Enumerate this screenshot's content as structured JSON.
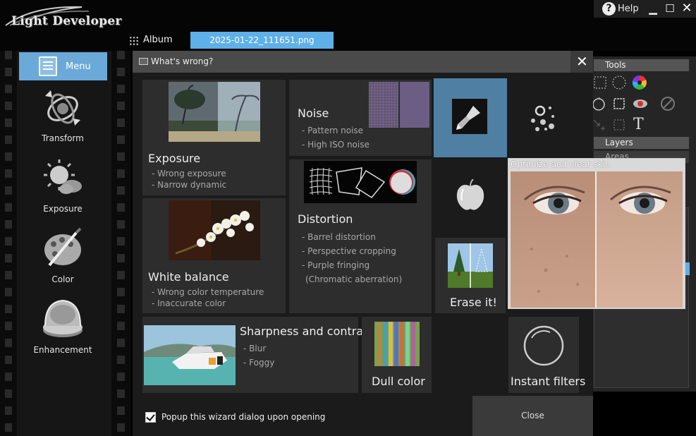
{
  "app": {
    "title": "Light Developer"
  },
  "window_controls": {
    "help": "Help",
    "help_glyph": "?",
    "minimize": "▁",
    "maximize": "☐",
    "close": "✕"
  },
  "header": {
    "album_label": "Album",
    "file_tab": "2025-01-22_111651.png"
  },
  "sidebar": {
    "menu_label": "Menu",
    "items": [
      {
        "label": "Transform",
        "icon": "transform-icon"
      },
      {
        "label": "Exposure",
        "icon": "exposure-icon"
      },
      {
        "label": "Color",
        "icon": "color-palette-icon"
      },
      {
        "label": "Enhancement",
        "icon": "enhancement-compact-icon"
      }
    ]
  },
  "right_panel": {
    "tools_header": "Tools",
    "layers_header": "Layers",
    "areas_header": "Areas",
    "text_tool_glyph": "T"
  },
  "dialog": {
    "title": "What's wrong?",
    "close_glyph": "✕",
    "cards": {
      "exposure": {
        "title": "Exposure",
        "items": [
          "- Wrong exposure",
          "- Narrow dynamic"
        ]
      },
      "noise": {
        "title": "Noise",
        "items": [
          "- Pattern noise",
          "- High ISO noise"
        ]
      },
      "white_balance": {
        "title": "White balance",
        "items": [
          "- Wrong color temperature",
          "- Inaccurate color"
        ]
      },
      "distortion": {
        "title": "Distortion",
        "items": [
          "- Barrel distortion",
          "- Perspective cropping",
          "- Purple fringing",
          "(Chromatic aberration)"
        ]
      },
      "sharpness": {
        "title": "Sharpness and contrast",
        "items": [
          "- Blur",
          "- Foggy"
        ]
      },
      "dull_color": {
        "title": "Dull color"
      },
      "erase_it": {
        "title": "Erase it!"
      },
      "instant_filters": {
        "title": "Instant filters"
      },
      "skin_tooltip": {
        "title": "Optimize and clear skin"
      }
    },
    "popup_checkbox_label": "Popup this wizard dialog upon opening",
    "popup_checked": true,
    "close_button": "Close"
  },
  "colors": {
    "accent_blue": "#5eb0e9",
    "menu_blue": "#6aa9d8",
    "selected_tile": "#4f7fa3"
  }
}
